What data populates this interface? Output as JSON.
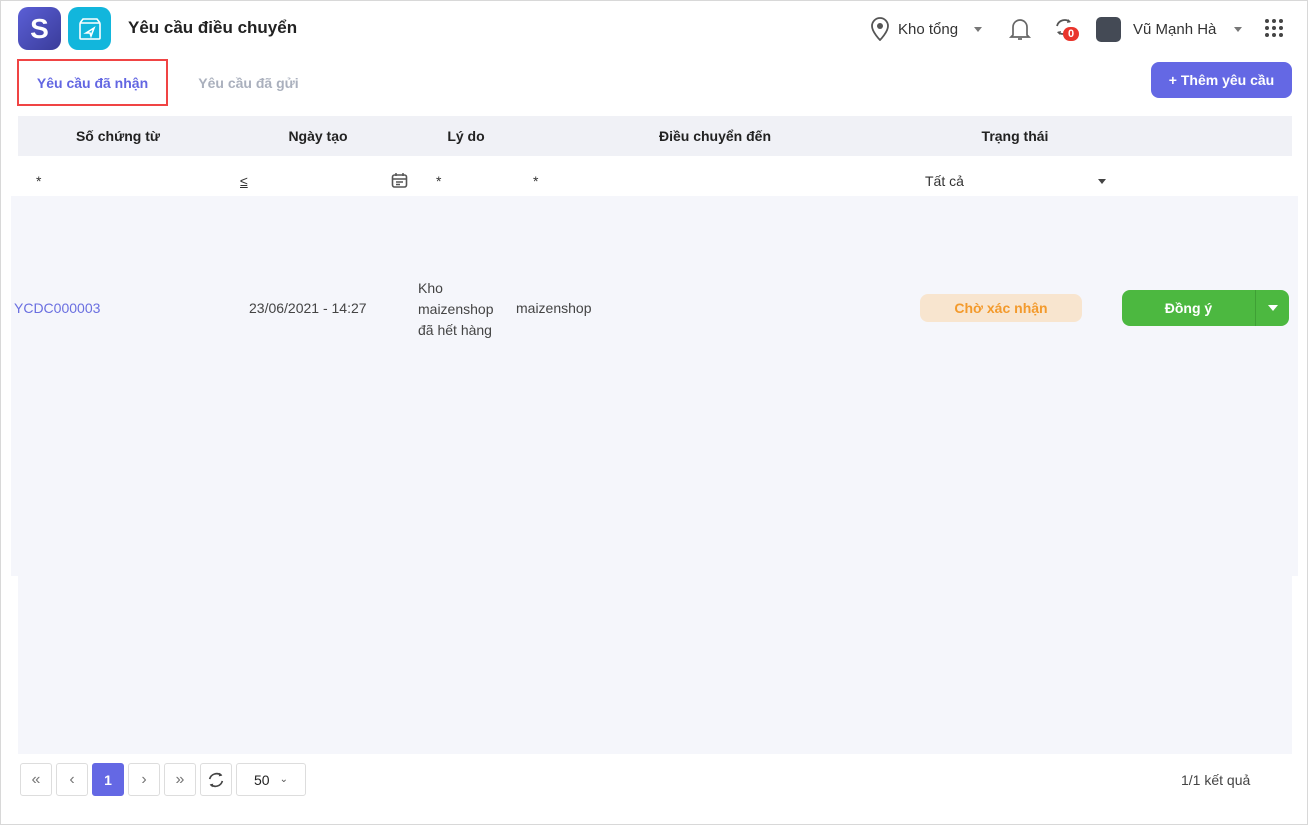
{
  "header": {
    "title": "Yêu cầu điều chuyển",
    "warehouse": "Kho tổng",
    "sync_count": "0",
    "user": "Vũ Mạnh Hà"
  },
  "tabs": [
    {
      "label": "Yêu cầu đã nhận",
      "active": true
    },
    {
      "label": "Yêu cầu đã gửi",
      "active": false
    }
  ],
  "add_button": "+ Thêm yêu cầu",
  "table": {
    "columns": [
      "Số chứng từ",
      "Ngày tạo",
      "Lý do",
      "Điều chuyển đến",
      "Trạng thái"
    ],
    "filters": {
      "code": "*",
      "date": "≤",
      "reason": "*",
      "dest": "*",
      "status": "Tất cả"
    },
    "rows": [
      {
        "code": "YCDC000003",
        "date": "23/06/2021 - 14:27",
        "reason": "Kho maizenshop đã hết hàng",
        "dest": "maizenshop",
        "status": "Chờ xác nhận",
        "action": "Đồng ý"
      }
    ]
  },
  "pagination": {
    "current": "1",
    "page_size": "50",
    "summary": "1/1 kết quả"
  }
}
